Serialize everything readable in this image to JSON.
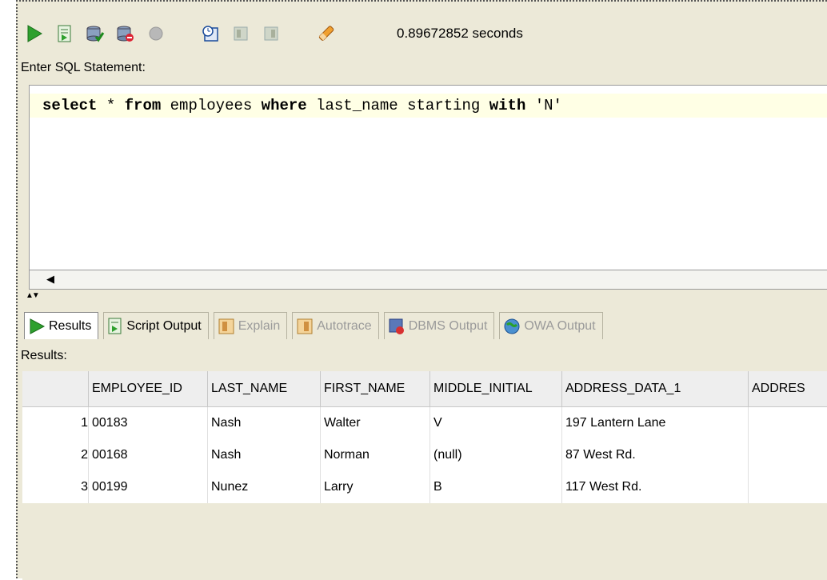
{
  "toolbar": {
    "icons": [
      "run-statement-icon",
      "run-script-icon",
      "commit-icon",
      "rollback-icon",
      "cancel-icon",
      "execution-plan-icon",
      "autotrace-icon",
      "sql-history-icon",
      "clear-icon"
    ],
    "elapsed": "0.89672852 seconds"
  },
  "editor": {
    "label": "Enter SQL Statement:",
    "tokens": {
      "t1": "select",
      "t2": " * ",
      "t3": "from",
      "t4": " employees ",
      "t5": "where",
      "t6": " last_name starting ",
      "t7": "with",
      "t8": " ",
      "t9": "'N'"
    }
  },
  "tabs": [
    {
      "label": "Results",
      "icon": "run-icon",
      "active": true
    },
    {
      "label": "Script Output",
      "icon": "script-icon",
      "active": false
    },
    {
      "label": "Explain",
      "icon": "explain-icon",
      "disabled": true
    },
    {
      "label": "Autotrace",
      "icon": "autotrace-icon",
      "disabled": true
    },
    {
      "label": "DBMS Output",
      "icon": "dbms-icon",
      "disabled": true
    },
    {
      "label": "OWA Output",
      "icon": "owa-icon",
      "disabled": true
    }
  ],
  "results": {
    "label": "Results:",
    "columns": [
      "EMPLOYEE_ID",
      "LAST_NAME",
      "FIRST_NAME",
      "MIDDLE_INITIAL",
      "ADDRESS_DATA_1",
      "ADDRES"
    ],
    "rows": [
      {
        "n": "1",
        "cells": [
          "00183",
          "Nash",
          "Walter",
          "V",
          "197 Lantern Lane",
          ""
        ]
      },
      {
        "n": "2",
        "cells": [
          "00168",
          "Nash",
          "Norman",
          "(null)",
          "87 West Rd.",
          ""
        ]
      },
      {
        "n": "3",
        "cells": [
          "00199",
          "Nunez",
          "Larry",
          "B",
          "117 West Rd.",
          ""
        ]
      }
    ]
  },
  "colors": {
    "run_green": "#2ea02e",
    "editor_highlight": "#ffffe5",
    "grid_header": "#eeeeee"
  }
}
